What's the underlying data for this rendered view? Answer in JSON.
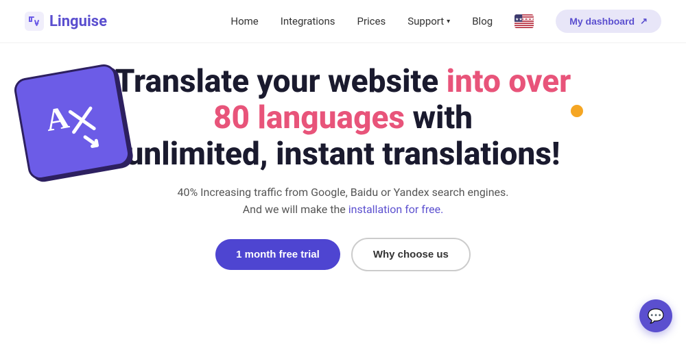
{
  "brand": {
    "name": "Linguise",
    "icon_alt": "linguise-logo-icon"
  },
  "nav": {
    "links": [
      {
        "label": "Home",
        "name": "nav-home",
        "has_dropdown": false
      },
      {
        "label": "Integrations",
        "name": "nav-integrations",
        "has_dropdown": false
      },
      {
        "label": "Prices",
        "name": "nav-prices",
        "has_dropdown": false
      },
      {
        "label": "Support",
        "name": "nav-support",
        "has_dropdown": true
      },
      {
        "label": "Blog",
        "name": "nav-blog",
        "has_dropdown": false
      }
    ],
    "dashboard_button": "My dashboard",
    "flag_alt": "us-flag"
  },
  "hero": {
    "title_part1": "Translate your website ",
    "title_highlight": "into over 80 languages",
    "title_part2": " with unlimited, instant translations!",
    "subtitle_line1": "40% Increasing traffic from Google, Baidu or Yandex search engines.",
    "subtitle_line2": "And we will make the ",
    "subtitle_link": "installation for free.",
    "cta_primary": "1 month free trial",
    "cta_secondary": "Why choose us"
  },
  "colors": {
    "brand_purple": "#5b4fcf",
    "highlight_pink": "#e8547a",
    "orange_dot": "#f5a623",
    "btn_primary": "#4e45d1",
    "dashboard_bg": "#e8e6f8"
  }
}
